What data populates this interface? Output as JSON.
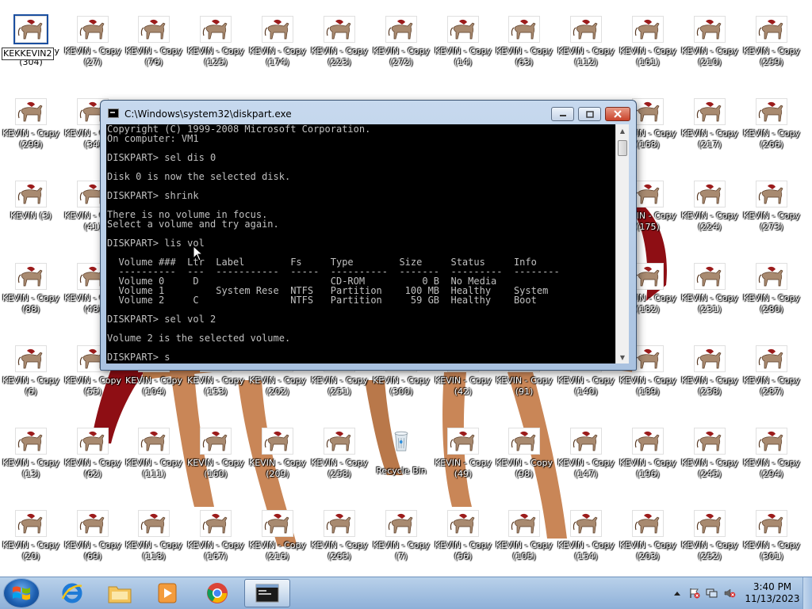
{
  "desktop": {
    "icons": [
      {
        "label": "KEVIN - Copy",
        "num": "(304)",
        "col": 0,
        "row": 0,
        "selected": true
      },
      {
        "label": "KEVIN - Copy",
        "num": "(27)",
        "col": 1,
        "row": 0
      },
      {
        "label": "KEVIN - Copy",
        "num": "(76)",
        "col": 2,
        "row": 0
      },
      {
        "label": "KEVIN - Copy",
        "num": "(125)",
        "col": 3,
        "row": 0
      },
      {
        "label": "KEVIN - Copy",
        "num": "(174)",
        "col": 4,
        "row": 0
      },
      {
        "label": "KEVIN - Copy",
        "num": "(223)",
        "col": 5,
        "row": 0
      },
      {
        "label": "KEVIN - Copy",
        "num": "(272)",
        "col": 6,
        "row": 0
      },
      {
        "label": "KEVIN - Copy",
        "num": "(14)",
        "col": 7,
        "row": 0
      },
      {
        "label": "KEVIN - Copy",
        "num": "(63)",
        "col": 8,
        "row": 0
      },
      {
        "label": "KEVIN - Copy",
        "num": "(112)",
        "col": 9,
        "row": 0
      },
      {
        "label": "KEVIN - Copy",
        "num": "(161)",
        "col": 10,
        "row": 0
      },
      {
        "label": "KEVIN - Copy",
        "num": "(210)",
        "col": 11,
        "row": 0
      },
      {
        "label": "KEVIN - Copy",
        "num": "(259)",
        "col": 12,
        "row": 0
      },
      {
        "label": "KEVIN - Copy",
        "num": "(299)",
        "col": 0,
        "row": 1
      },
      {
        "label": "KEVIN - Copy",
        "num": "(34)",
        "col": 1,
        "row": 1
      },
      {
        "label": "KEVIN - Copy",
        "num": "(168)",
        "col": 10,
        "row": 1
      },
      {
        "label": "KEVIN - Copy",
        "num": "(217)",
        "col": 11,
        "row": 1
      },
      {
        "label": "KEVIN - Copy",
        "num": "(266)",
        "col": 12,
        "row": 1
      },
      {
        "label": "KEVIN (3)",
        "num": "",
        "col": 0,
        "row": 2
      },
      {
        "label": "KEVIN - Copy",
        "num": "(41)",
        "col": 1,
        "row": 2
      },
      {
        "label": "KEVIN - Copy",
        "num": "(175)",
        "col": 10,
        "row": 2
      },
      {
        "label": "KEVIN - Copy",
        "num": "(224)",
        "col": 11,
        "row": 2
      },
      {
        "label": "KEVIN - Copy",
        "num": "(273)",
        "col": 12,
        "row": 2
      },
      {
        "label": "KEVIN - Copy",
        "num": "(88)",
        "col": 0,
        "row": 3
      },
      {
        "label": "KEVIN - Copy",
        "num": "(48)",
        "col": 1,
        "row": 3
      },
      {
        "label": "KEVIN - Copy",
        "num": "(182)",
        "col": 10,
        "row": 3
      },
      {
        "label": "KEVIN - Copy",
        "num": "(231)",
        "col": 11,
        "row": 3
      },
      {
        "label": "KEVIN - Copy",
        "num": "(280)",
        "col": 12,
        "row": 3
      },
      {
        "label": "KEVIN - Copy",
        "num": "(6)",
        "col": 0,
        "row": 4
      },
      {
        "label": "KEVIN - Copy",
        "num": "(55)",
        "col": 1,
        "row": 4
      },
      {
        "label": "KEVIN - Copy",
        "num": "(104)",
        "col": 2,
        "row": 4
      },
      {
        "label": "KEVIN - Copy",
        "num": "(153)",
        "col": 3,
        "row": 4
      },
      {
        "label": "KEVIN - Copy",
        "num": "(202)",
        "col": 4,
        "row": 4
      },
      {
        "label": "KEVIN - Copy",
        "num": "(251)",
        "col": 5,
        "row": 4
      },
      {
        "label": "KEVIN - Copy",
        "num": "(300)",
        "col": 6,
        "row": 4
      },
      {
        "label": "KEVIN - Copy",
        "num": "(42)",
        "col": 7,
        "row": 4
      },
      {
        "label": "KEVIN - Copy",
        "num": "(91)",
        "col": 8,
        "row": 4
      },
      {
        "label": "KEVIN - Copy",
        "num": "(140)",
        "col": 9,
        "row": 4
      },
      {
        "label": "KEVIN - Copy",
        "num": "(189)",
        "col": 10,
        "row": 4
      },
      {
        "label": "KEVIN - Copy",
        "num": "(238)",
        "col": 11,
        "row": 4
      },
      {
        "label": "KEVIN - Copy",
        "num": "(287)",
        "col": 12,
        "row": 4
      },
      {
        "label": "KEVIN - Copy",
        "num": "(13)",
        "col": 0,
        "row": 5
      },
      {
        "label": "KEVIN - Copy",
        "num": "(62)",
        "col": 1,
        "row": 5
      },
      {
        "label": "KEVIN - Copy",
        "num": "(111)",
        "col": 2,
        "row": 5
      },
      {
        "label": "KEVIN - Copy",
        "num": "(160)",
        "col": 3,
        "row": 5
      },
      {
        "label": "KEVIN - Copy",
        "num": "(209)",
        "col": 4,
        "row": 5
      },
      {
        "label": "KEVIN - Copy",
        "num": "(258)",
        "col": 5,
        "row": 5
      },
      {
        "label": "Recycle Bin",
        "num": "",
        "col": 6,
        "row": 5,
        "kind": "recycle"
      },
      {
        "label": "KEVIN - Copy",
        "num": "(49)",
        "col": 7,
        "row": 5
      },
      {
        "label": "KEVIN - Copy",
        "num": "(98)",
        "col": 8,
        "row": 5
      },
      {
        "label": "KEVIN - Copy",
        "num": "(147)",
        "col": 9,
        "row": 5
      },
      {
        "label": "KEVIN - Copy",
        "num": "(196)",
        "col": 10,
        "row": 5
      },
      {
        "label": "KEVIN - Copy",
        "num": "(245)",
        "col": 11,
        "row": 5
      },
      {
        "label": "KEVIN - Copy",
        "num": "(294)",
        "col": 12,
        "row": 5
      },
      {
        "label": "KEVIN - Copy",
        "num": "(20)",
        "col": 0,
        "row": 6
      },
      {
        "label": "KEVIN - Copy",
        "num": "(69)",
        "col": 1,
        "row": 6
      },
      {
        "label": "KEVIN - Copy",
        "num": "(118)",
        "col": 2,
        "row": 6
      },
      {
        "label": "KEVIN - Copy",
        "num": "(167)",
        "col": 3,
        "row": 6
      },
      {
        "label": "KEVIN - Copy",
        "num": "(216)",
        "col": 4,
        "row": 6
      },
      {
        "label": "KEVIN - Copy",
        "num": "(265)",
        "col": 5,
        "row": 6
      },
      {
        "label": "KEVIN - Copy",
        "num": "(7)",
        "col": 6,
        "row": 6
      },
      {
        "label": "KEVIN - Copy",
        "num": "(56)",
        "col": 7,
        "row": 6
      },
      {
        "label": "KEVIN - Copy",
        "num": "(105)",
        "col": 8,
        "row": 6
      },
      {
        "label": "KEVIN - Copy",
        "num": "(154)",
        "col": 9,
        "row": 6
      },
      {
        "label": "KEVIN - Copy",
        "num": "(203)",
        "col": 10,
        "row": 6
      },
      {
        "label": "KEVIN - Copy",
        "num": "(252)",
        "col": 11,
        "row": 6
      },
      {
        "label": "KEVIN - Copy",
        "num": "(301)",
        "col": 12,
        "row": 6
      }
    ],
    "rename_overlay": "KEKKEVIN2"
  },
  "window": {
    "title": "C:\\Windows\\system32\\diskpart.exe",
    "console_lines": [
      "Copyright (C) 1999-2008 Microsoft Corporation.",
      "On computer: VM1",
      "",
      "DISKPART> sel dis 0",
      "",
      "Disk 0 is now the selected disk.",
      "",
      "DISKPART> shrink",
      "",
      "There is no volume in focus.",
      "Select a volume and try again.",
      "",
      "DISKPART> lis vol",
      "",
      "  Volume ###  Ltr  Label        Fs     Type        Size     Status     Info",
      "  ----------  ---  -----------  -----  ----------  -------  ---------  --------",
      "  Volume 0     D                       CD-ROM          0 B  No Media",
      "  Volume 1         System Rese  NTFS   Partition    100 MB  Healthy    System",
      "  Volume 2     C                NTFS   Partition     59 GB  Healthy    Boot",
      "",
      "DISKPART> sel vol 2",
      "",
      "Volume 2 is the selected volume.",
      "",
      "DISKPART> s"
    ]
  },
  "taskbar": {
    "pinned": [
      {
        "name": "internet-explorer-button",
        "icon": "internet-explorer-icon"
      },
      {
        "name": "windows-explorer-button",
        "icon": "folder-icon"
      },
      {
        "name": "media-player-button",
        "icon": "media-player-icon"
      },
      {
        "name": "chrome-button",
        "icon": "chrome-icon"
      },
      {
        "name": "cmd-taskbar-button",
        "icon": "console-icon"
      }
    ],
    "clock": {
      "time": "3:40 PM",
      "date": "11/13/2023"
    },
    "tray_icons": [
      "show-hidden-icons-icon",
      "action-center-flag-icon",
      "network-icon",
      "volume-muted-icon"
    ]
  },
  "colors": {
    "console_bg": "#000000",
    "console_fg": "#c0c0c0",
    "taskbar": "#a9c6e8",
    "icon_horse": "#9b1b1b"
  }
}
